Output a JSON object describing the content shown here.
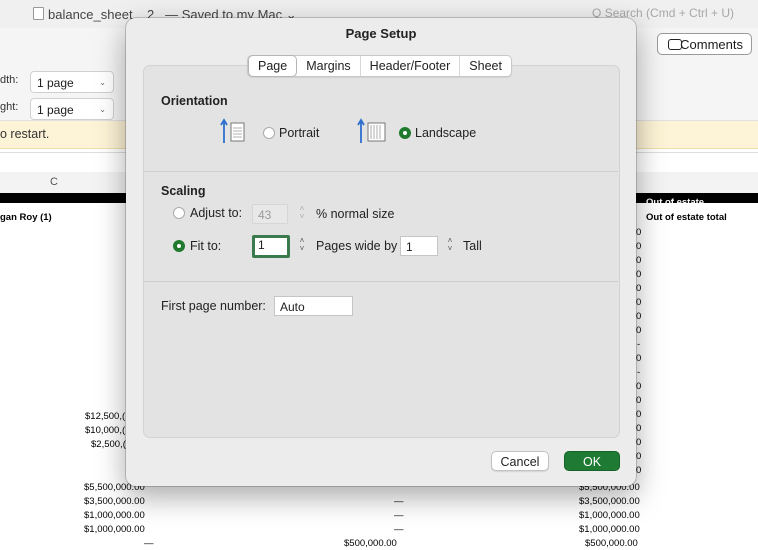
{
  "window": {
    "doc_title": "balance_sheet__2_",
    "save_status": "— Saved to my Mac ⌄",
    "search_placeholder": "Search (Cmd + Ctrl + U)",
    "search_glyph": "Q"
  },
  "ribbon": {
    "width_label": "dth:",
    "width_value": "1 page",
    "height_label": "ght:",
    "height_value": "1 page",
    "comments_label": "Comments"
  },
  "notice": {
    "text": "o restart."
  },
  "sheet": {
    "column_c": "C",
    "row_name": "gan Roy (1)",
    "out_of_estate": "Out of estate",
    "out_of_estate_total": "Out of estate total",
    "left_values": [
      "$12,500,(",
      "$10,000,(",
      "$2,500,(",
      "$5,500,000.00",
      "$3,500,000.00",
      "$1,000,000.00",
      "$1,000,000.00"
    ],
    "dash": "—",
    "mid_value": "$500,000.00",
    "right_values": [
      "$3,500,000.00",
      "$1,000,000.00",
      "$1,000,000.00",
      "$500,000.00"
    ],
    "right_partial": "$5,500,000.00",
    "right_zero": "0",
    "right_dash": "-"
  },
  "dialog": {
    "title": "Page Setup",
    "tabs": [
      "Page",
      "Margins",
      "Header/Footer",
      "Sheet"
    ],
    "active_tab": "Page",
    "orientation": {
      "heading": "Orientation",
      "portrait_label": "Portrait",
      "landscape_label": "Landscape",
      "selected": "Landscape"
    },
    "scaling": {
      "heading": "Scaling",
      "adjust_label": "Adjust to:",
      "adjust_value": "43",
      "adjust_suffix": "% normal size",
      "fit_label": "Fit to:",
      "fit_wide_value": "1",
      "fit_wide_label": "Pages wide by",
      "fit_tall_value": "1",
      "fit_tall_label": "Tall",
      "selected": "Fit to"
    },
    "first_page": {
      "label": "First page number:",
      "value": "Auto"
    },
    "buttons": {
      "cancel": "Cancel",
      "ok": "OK"
    },
    "accent_color": "#1f7a34"
  }
}
